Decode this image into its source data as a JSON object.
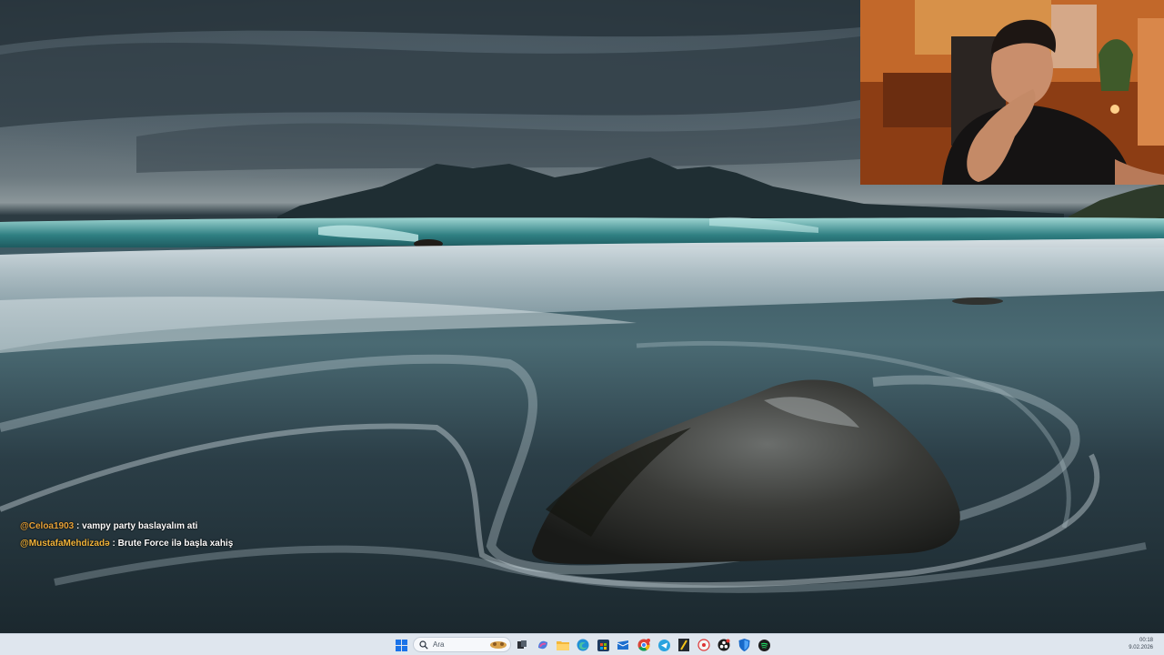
{
  "chat": {
    "messages": [
      {
        "user": "@Celoa1903",
        "separator": ":",
        "text": "vampy party baslayalım ati"
      },
      {
        "user": "@MustafaMehdizadə",
        "separator": ":",
        "text": "Brute Force ilə başla xahiş"
      }
    ]
  },
  "taskbar": {
    "search_placeholder": "Ara",
    "icons": [
      "windows-start-icon",
      "search-icon",
      "task-view-icon",
      "copilot-icon",
      "file-explorer-icon",
      "edge-icon",
      "store-icon",
      "mail-icon",
      "chrome-icon",
      "telegram-icon",
      "notes-icon",
      "game-icon",
      "obs-icon",
      "defender-icon",
      "spotify-icon"
    ],
    "clock": {
      "time": "00:18",
      "date": "9.02.2026"
    }
  },
  "colors": {
    "chat_user": "#e8a33a",
    "chat_text": "#ffffff",
    "taskbar_bg": "#dfe6ee"
  }
}
